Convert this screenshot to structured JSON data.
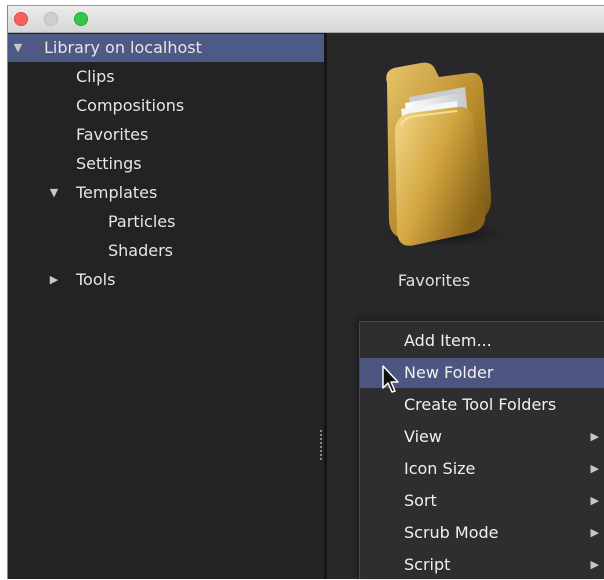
{
  "sidebar": {
    "root": {
      "label": "Library on localhost",
      "expanded": true
    },
    "items": [
      {
        "label": "Clips"
      },
      {
        "label": "Compositions"
      },
      {
        "label": "Favorites"
      },
      {
        "label": "Settings"
      },
      {
        "label": "Templates",
        "expanded": true,
        "children": [
          {
            "label": "Particles"
          },
          {
            "label": "Shaders"
          }
        ]
      },
      {
        "label": "Tools",
        "expanded": false
      }
    ]
  },
  "content": {
    "folder": {
      "label": "Favorites",
      "icon": "folder-icon"
    }
  },
  "context_menu": {
    "highlighted": "New Folder",
    "items": [
      {
        "label": "Add Item...",
        "submenu": false
      },
      {
        "label": "New Folder",
        "submenu": false
      },
      {
        "label": "Create Tool Folders",
        "submenu": false
      },
      {
        "label": "View",
        "submenu": true
      },
      {
        "label": "Icon Size",
        "submenu": true
      },
      {
        "label": "Sort",
        "submenu": true
      },
      {
        "label": "Scrub Mode",
        "submenu": true
      },
      {
        "label": "Script",
        "submenu": true
      }
    ]
  },
  "colors": {
    "selection": "#4e5a86",
    "menu_highlight": "#4c5680",
    "panel_bg": "#232325",
    "content_bg": "#28282a"
  }
}
